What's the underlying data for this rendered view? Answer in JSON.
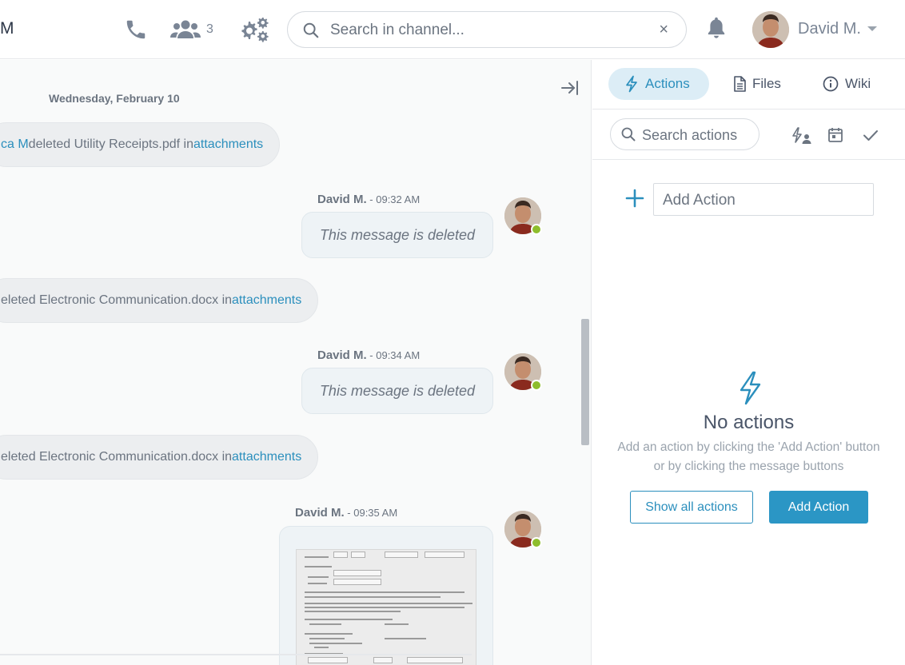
{
  "header": {
    "brand": "M",
    "participants_count": "3",
    "search": {
      "placeholder": "Search in channel...",
      "clear": "×"
    },
    "user": {
      "name": "David M."
    }
  },
  "chat": {
    "date_separator": "Wednesday, February 10",
    "system_messages": [
      {
        "prefix": "ca M",
        "text": " deleted Utility Receipts.pdf in ",
        "link": "attachments"
      },
      {
        "prefix": "",
        "text": "eleted Electronic Communication.docx in ",
        "link": "attachments"
      },
      {
        "prefix": "",
        "text": "eleted Electronic Communication.docx in ",
        "link": "attachments"
      }
    ],
    "messages": [
      {
        "author": "David M.",
        "time": " - 09:32 AM",
        "text": "This message is deleted"
      },
      {
        "author": "David M.",
        "time": " - 09:34 AM",
        "text": "This message is deleted"
      },
      {
        "author": "David M.",
        "time": " - 09:35 AM",
        "text": ""
      }
    ]
  },
  "panel": {
    "tabs": [
      {
        "label": "Actions",
        "icon": "lightning-icon"
      },
      {
        "label": "Files",
        "icon": "file-icon"
      },
      {
        "label": "Wiki",
        "icon": "info-icon"
      }
    ],
    "search_placeholder": "Search actions",
    "add_action_placeholder": "Add Action",
    "empty": {
      "title": "No actions",
      "description": "Add an action by clicking the 'Add Action' button or by clicking the message buttons"
    },
    "buttons": {
      "show_all": "Show all actions",
      "add": "Add Action"
    }
  },
  "colors": {
    "accent": "#2b96c5",
    "online": "#8ebd2c",
    "icon": "#7a8595"
  }
}
